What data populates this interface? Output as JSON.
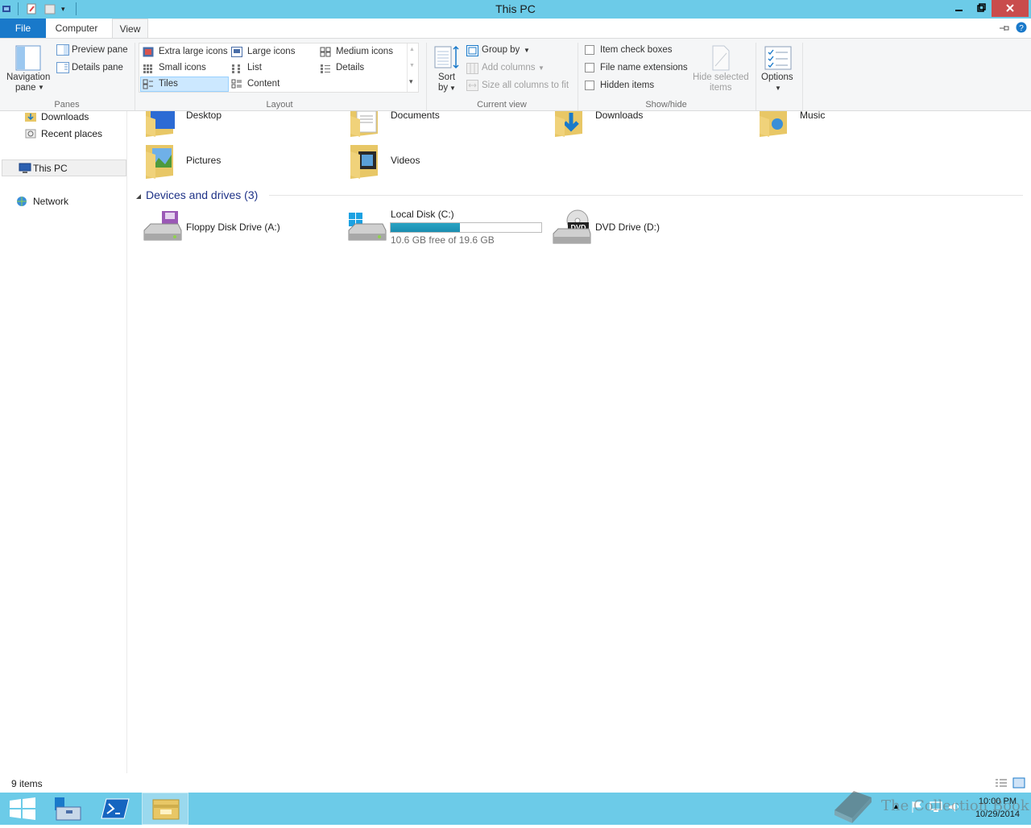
{
  "window": {
    "title": "This PC"
  },
  "ribbon_tabs": {
    "file": "File",
    "computer": "Computer",
    "view": "View"
  },
  "ribbon": {
    "panes": {
      "group_label": "Panes",
      "navigation_pane_line1": "Navigation",
      "navigation_pane_line2": "pane",
      "preview_pane": "Preview pane",
      "details_pane": "Details pane"
    },
    "layout": {
      "group_label": "Layout",
      "options": [
        "Extra large icons",
        "Large icons",
        "Medium icons",
        "Small icons",
        "List",
        "Details",
        "Tiles",
        "Content"
      ],
      "selected": "Tiles"
    },
    "current_view": {
      "group_label": "Current view",
      "sort_by_line1": "Sort",
      "sort_by_line2": "by",
      "group_by": "Group by",
      "add_columns": "Add columns",
      "size_all_columns": "Size all columns to fit"
    },
    "show_hide": {
      "group_label": "Show/hide",
      "item_check_boxes": "Item check boxes",
      "file_name_extensions": "File name extensions",
      "hidden_items": "Hidden items",
      "hide_selected_line1": "Hide selected",
      "hide_selected_line2": "items"
    },
    "options": {
      "label": "Options"
    }
  },
  "nav": {
    "downloads": "Downloads",
    "recent_places": "Recent places",
    "this_pc": "This PC",
    "network": "Network"
  },
  "folders": [
    "Desktop",
    "Documents",
    "Downloads",
    "Music",
    "Pictures",
    "Videos"
  ],
  "devices_section": {
    "header": "Devices and drives (3)",
    "drives": [
      {
        "name": "Floppy Disk Drive (A:)"
      },
      {
        "name": "Local Disk (C:)",
        "free_text": "10.6 GB free of 19.6 GB",
        "used_fraction": 0.46
      },
      {
        "name": "DVD Drive (D:)"
      }
    ]
  },
  "status": {
    "items_count": "9 items"
  },
  "taskbar": {
    "time": "10:00 PM",
    "date": "10/29/2014"
  },
  "watermark": {
    "text": "The Collection Book"
  },
  "colors": {
    "titlebar": "#6ccbe8",
    "file_tab": "#1979ca",
    "close_button": "#c94c4c",
    "drive_bar": "#2aa3c3",
    "section_header": "#1e3287"
  }
}
